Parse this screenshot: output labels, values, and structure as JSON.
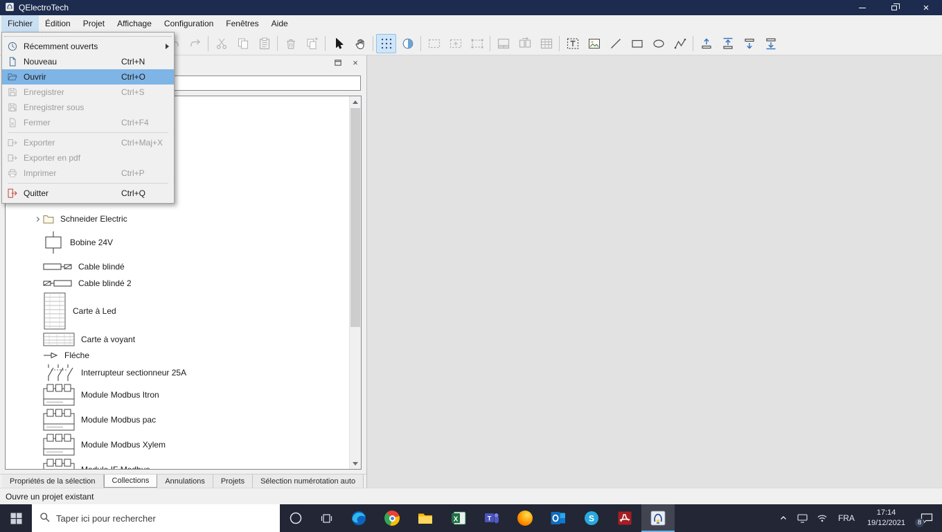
{
  "window": {
    "title": "QElectroTech"
  },
  "menubar": {
    "items": [
      {
        "label": "Fichier",
        "active": true
      },
      {
        "label": "Édition"
      },
      {
        "label": "Projet"
      },
      {
        "label": "Affichage"
      },
      {
        "label": "Configuration"
      },
      {
        "label": "Fenêtres"
      },
      {
        "label": "Aide"
      }
    ]
  },
  "toolbar": {
    "groups": [
      [
        {
          "name": "new-document-icon"
        },
        {
          "name": "open-icon"
        },
        {
          "name": "save-icon",
          "disabled": true
        },
        {
          "name": "save-as-icon",
          "disabled": true
        },
        {
          "name": "close-file-icon",
          "disabled": true
        }
      ],
      [
        {
          "name": "print-icon",
          "disabled": true
        },
        {
          "name": "export-icon",
          "disabled": true
        }
      ],
      [
        {
          "name": "undo-icon",
          "disabled": true
        },
        {
          "name": "redo-icon",
          "disabled": true
        }
      ],
      [
        {
          "name": "cut-icon",
          "disabled": true
        },
        {
          "name": "copy-icon",
          "disabled": true
        },
        {
          "name": "paste-icon",
          "disabled": true
        }
      ],
      [
        {
          "name": "delete-icon",
          "disabled": true
        },
        {
          "name": "duplicate-icon",
          "disabled": true
        }
      ],
      [
        {
          "name": "pointer-icon"
        },
        {
          "name": "pan-hand-icon"
        }
      ],
      [
        {
          "name": "grid-toggle-icon",
          "active": true
        },
        {
          "name": "display-mask-icon"
        }
      ],
      [
        {
          "name": "selection-rect-icon",
          "disabled": true
        },
        {
          "name": "move-selection-icon",
          "disabled": true
        },
        {
          "name": "resize-selection-icon",
          "disabled": true
        }
      ],
      [
        {
          "name": "titleblock-icon",
          "disabled": true
        },
        {
          "name": "fold-icon",
          "disabled": true
        },
        {
          "name": "conductor-table-icon",
          "disabled": true
        }
      ],
      [
        {
          "name": "add-text-icon"
        },
        {
          "name": "add-image-icon"
        },
        {
          "name": "add-line-icon"
        },
        {
          "name": "add-rectangle-icon"
        },
        {
          "name": "add-ellipse-icon"
        },
        {
          "name": "add-polyline-icon"
        }
      ],
      [
        {
          "name": "depth-raise-icon"
        },
        {
          "name": "depth-top-icon"
        },
        {
          "name": "depth-lower-icon"
        },
        {
          "name": "depth-bottom-icon"
        }
      ]
    ]
  },
  "file_menu": {
    "items": [
      {
        "label": "Récemment ouverts",
        "icon": "recent-icon",
        "submenu": true,
        "enabled": true
      },
      {
        "label": "Nouveau",
        "icon": "new-document-icon",
        "shortcut": "Ctrl+N",
        "enabled": true
      },
      {
        "label": "Ouvrir",
        "icon": "open-icon",
        "shortcut": "Ctrl+O",
        "enabled": true,
        "highlighted": true
      },
      {
        "label": "Enregistrer",
        "icon": "save-icon",
        "shortcut": "Ctrl+S",
        "enabled": false
      },
      {
        "label": "Enregistrer sous",
        "icon": "save-as-icon",
        "enabled": false
      },
      {
        "label": "Fermer",
        "icon": "close-file-icon",
        "shortcut": "Ctrl+F4",
        "enabled": false
      },
      {
        "separator": true
      },
      {
        "label": "Exporter",
        "icon": "export-icon",
        "shortcut": "Ctrl+Maj+X",
        "enabled": false
      },
      {
        "label": "Exporter en pdf",
        "icon": "export-pdf-icon",
        "enabled": false
      },
      {
        "label": "Imprimer",
        "icon": "print-icon",
        "shortcut": "Ctrl+P",
        "enabled": false
      },
      {
        "separator": true
      },
      {
        "label": "Quitter",
        "icon": "quit-icon",
        "shortcut": "Ctrl+Q",
        "enabled": true
      }
    ]
  },
  "collections_panel": {
    "search_value": "",
    "tree_items": [
      {
        "label": "Schneider Electric",
        "icon": "folder-icon",
        "expandable": true
      },
      {
        "label": "Bobine 24V",
        "icon": "coil-icon"
      },
      {
        "label": "Cable blindé",
        "icon": "cable-icon"
      },
      {
        "label": "Cable blindé 2",
        "icon": "cable2-icon"
      },
      {
        "label": "Carte à Led",
        "icon": "card-led-icon"
      },
      {
        "label": "Carte à voyant",
        "icon": "card-voyant-icon"
      },
      {
        "label": "Fléche",
        "icon": "arrow-icon"
      },
      {
        "label": "Interrupteur sectionneur 25A",
        "icon": "switch-icon"
      },
      {
        "label": "Module Modbus Itron",
        "icon": "module-icon"
      },
      {
        "label": "Module Modbus pac",
        "icon": "module-icon"
      },
      {
        "label": "Module Modbus Xylem",
        "icon": "module-icon"
      },
      {
        "label": "Module IF Modbus",
        "icon": "module-icon"
      }
    ]
  },
  "bottom_tabs": {
    "items": [
      {
        "label": "Propriétés de la sélection"
      },
      {
        "label": "Collections",
        "active": true
      },
      {
        "label": "Annulations"
      },
      {
        "label": "Projets"
      },
      {
        "label": "Sélection numérotation auto"
      }
    ]
  },
  "statusbar": {
    "text": "Ouvre un projet existant"
  },
  "taskbar": {
    "search_placeholder": "Taper ici pour rechercher",
    "apps": [
      {
        "name": "edge-icon"
      },
      {
        "name": "chrome-icon"
      },
      {
        "name": "explorer-icon"
      },
      {
        "name": "excel-icon"
      },
      {
        "name": "teams-icon"
      },
      {
        "name": "firefox-icon"
      },
      {
        "name": "outlook-icon"
      },
      {
        "name": "skype-icon"
      },
      {
        "name": "acrobat-icon"
      },
      {
        "name": "qelectrotech-icon",
        "active": true
      }
    ],
    "tray": {
      "language": "FRA",
      "time": "17:14",
      "date": "19/12/2021",
      "notification_count": "8"
    }
  },
  "colors": {
    "titlebar": "#1c2b4e",
    "menu_highlight": "#7fb4e6",
    "toolbar_active_bg": "#cfe6f9",
    "taskbar": "#232635"
  }
}
